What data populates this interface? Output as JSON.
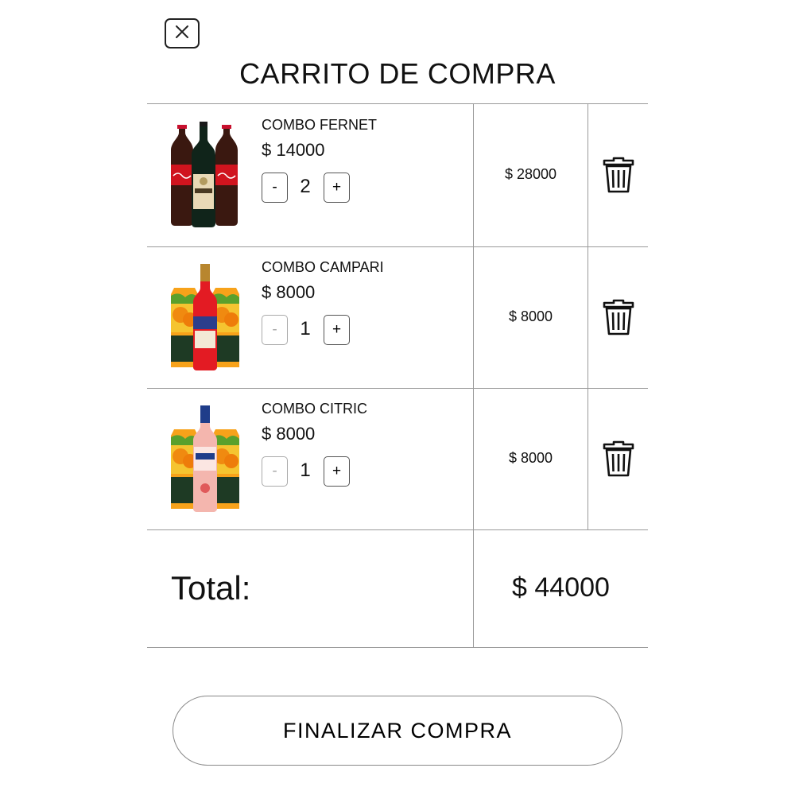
{
  "cart": {
    "title": "CARRITO DE COMPRA",
    "close_icon": "close-icon",
    "items": [
      {
        "name": "COMBO FERNET",
        "unit_price": "$ 14000",
        "minus_label": "-",
        "quantity": "2",
        "plus_label": "+",
        "subtotal": "$ 28000",
        "delete_icon": "trash-icon",
        "image": "fernet-combo-image"
      },
      {
        "name": "COMBO CAMPARI",
        "unit_price": "$ 8000",
        "minus_label": "-",
        "quantity": "1",
        "plus_label": "+",
        "subtotal": "$ 8000",
        "delete_icon": "trash-icon",
        "image": "campari-combo-image"
      },
      {
        "name": "COMBO CITRIC",
        "unit_price": "$ 8000",
        "minus_label": "-",
        "quantity": "1",
        "plus_label": "+",
        "subtotal": "$ 8000",
        "delete_icon": "trash-icon",
        "image": "citric-combo-image"
      }
    ],
    "total_label": "Total:",
    "total_value": "$ 44000",
    "checkout_label": "FINALIZAR COMPRA"
  },
  "colors": {
    "border": "#9a9a9a",
    "text": "#111111",
    "disabled": "#aaaaaa"
  }
}
